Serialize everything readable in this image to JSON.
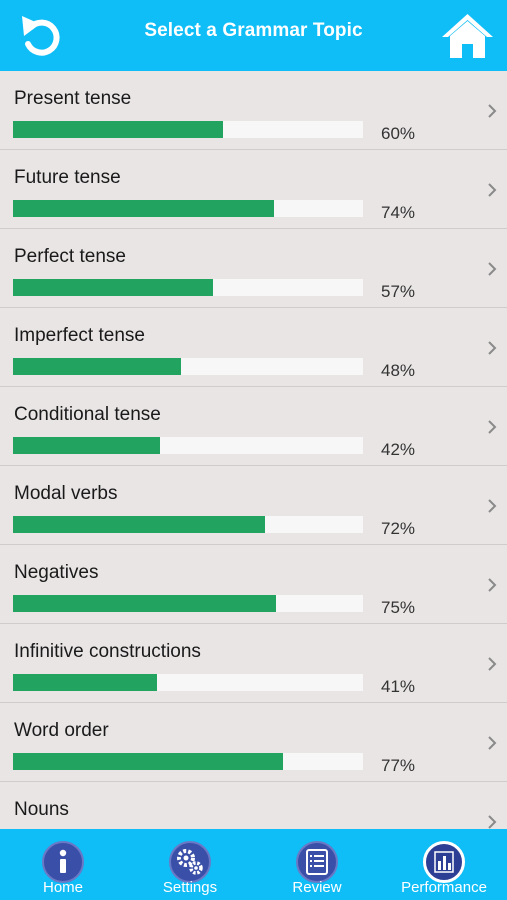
{
  "header": {
    "title": "Select a Grammar Topic",
    "back_icon": "undo-arrow-icon",
    "home_icon": "house-icon"
  },
  "colors": {
    "header_bg": "#0fbdf7",
    "bar_fill": "#22a35f",
    "tab_circle": "#3a4fa8"
  },
  "topics": [
    {
      "label": "Present tense",
      "percent_text": "60%",
      "fraction": 0.6
    },
    {
      "label": "Future tense",
      "percent_text": "74%",
      "fraction": 0.745
    },
    {
      "label": "Perfect tense",
      "percent_text": "57%",
      "fraction": 0.57
    },
    {
      "label": "Imperfect tense",
      "percent_text": "48%",
      "fraction": 0.48
    },
    {
      "label": "Conditional tense",
      "percent_text": "42%",
      "fraction": 0.42
    },
    {
      "label": "Modal verbs",
      "percent_text": "72%",
      "fraction": 0.72
    },
    {
      "label": "Negatives",
      "percent_text": "75%",
      "fraction": 0.75
    },
    {
      "label": "Infinitive constructions",
      "percent_text": "41%",
      "fraction": 0.41
    },
    {
      "label": "Word order",
      "percent_text": "77%",
      "fraction": 0.77
    },
    {
      "label": "Nouns",
      "percent_text": "",
      "fraction": 0
    }
  ],
  "tabs": [
    {
      "label": "Home",
      "icon": "info-icon"
    },
    {
      "label": "Settings",
      "icon": "gears-icon"
    },
    {
      "label": "Review",
      "icon": "list-icon"
    },
    {
      "label": "Performance",
      "icon": "bar-chart-icon"
    }
  ]
}
